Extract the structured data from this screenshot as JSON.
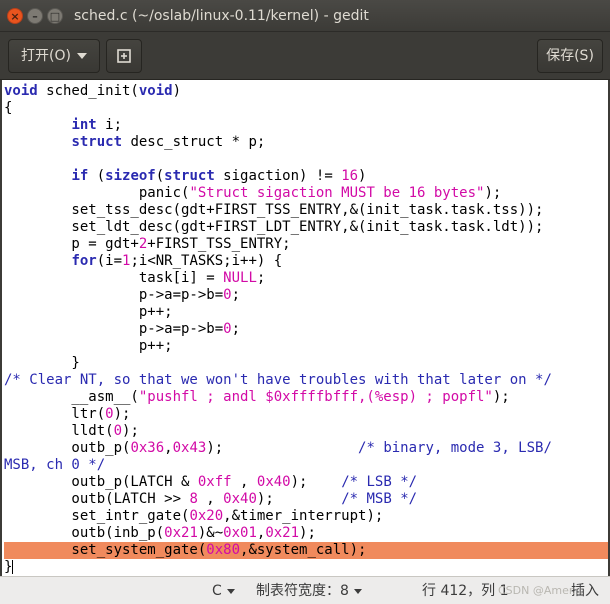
{
  "window": {
    "title": "sched.c (~/oslab/linux-0.11/kernel) - gedit",
    "close_glyph": "×",
    "min_glyph": "–",
    "max_glyph": "□"
  },
  "header": {
    "open_label": "打开(O)",
    "new_icon": "new-document-icon",
    "save_label": "保存(S)"
  },
  "colors": {
    "keyword": "#2a2ab0",
    "string": "#d20aa6",
    "current_line_highlight": "#f08a5d",
    "title_bar": "#3c3b37"
  },
  "code": {
    "lines": [
      "void sched_init(void)",
      "{",
      "        int i;",
      "        struct desc_struct * p;",
      "",
      "        if (sizeof(struct sigaction) != 16)",
      "                panic(\"Struct sigaction MUST be 16 bytes\");",
      "        set_tss_desc(gdt+FIRST_TSS_ENTRY,&(init_task.task.tss));",
      "        set_ldt_desc(gdt+FIRST_LDT_ENTRY,&(init_task.task.ldt));",
      "        p = gdt+2+FIRST_TSS_ENTRY;",
      "        for(i=1;i<NR_TASKS;i++) {",
      "                task[i] = NULL;",
      "                p->a=p->b=0;",
      "                p++;",
      "                p->a=p->b=0;",
      "                p++;",
      "        }",
      "/* Clear NT, so that we won't have troubles with that later on */",
      "        __asm__(\"pushfl ; andl $0xffffbfff,(%esp) ; popfl\");",
      "        ltr(0);",
      "        lldt(0);",
      "        outb_p(0x36,0x43);                /* binary, mode 3, LSB/",
      "MSB, ch 0 */",
      "        outb_p(LATCH & 0xff , 0x40);    /* LSB */",
      "        outb(LATCH >> 8 , 0x40);        /* MSB */",
      "        set_intr_gate(0x20,&timer_interrupt);",
      "        outb(inb_p(0x21)&~0x01,0x21);",
      "        set_system_gate(0x80,&system_call);",
      "}"
    ],
    "current_line_index": 27
  },
  "status": {
    "language": "C",
    "tab_width": "制表符宽度：8",
    "position": "行 412，列 1",
    "insert_mode": "插入",
    "watermark": "CSDN @Amer..."
  }
}
